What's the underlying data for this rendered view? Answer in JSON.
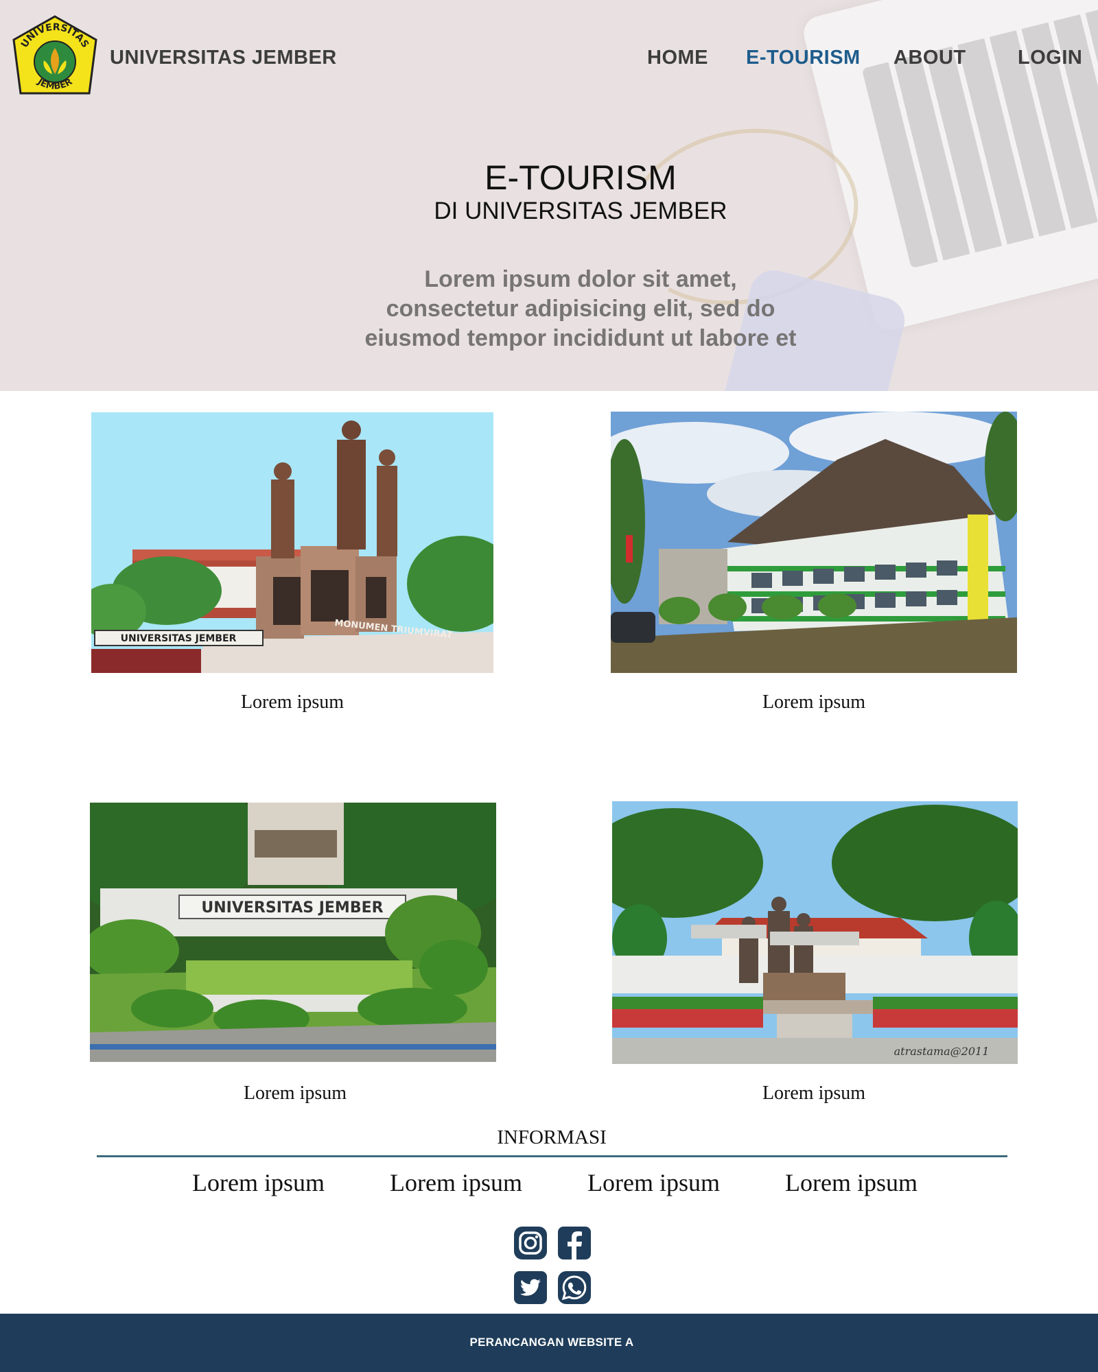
{
  "header": {
    "brand": "UNIVERSITAS JEMBER",
    "logo_ring_text_top": "UNIVERSITAS",
    "logo_ring_text_bottom": "JEMBER",
    "nav": [
      {
        "label": "HOME",
        "active": false
      },
      {
        "label": "E-TOURISM",
        "active": true
      },
      {
        "label": "ABOUT",
        "active": false
      },
      {
        "label": "LOGIN",
        "active": false
      }
    ]
  },
  "hero": {
    "title": "E-TOURISM",
    "subtitle": "DI UNIVERSITAS JEMBER",
    "description_lines": [
      "Lorem ipsum dolor sit amet,",
      "consectetur adipisicing elit, sed do",
      "eiusmod tempor incididunt ut labore et"
    ]
  },
  "gallery": [
    {
      "caption": "Lorem ipsum",
      "image": "monumen-triumvirat-photo",
      "sign_text": "UNIVERSITAS JEMBER",
      "plaque_text": "MONUMEN TRIUMVIRAT"
    },
    {
      "caption": "Lorem ipsum",
      "image": "campus-building-photo"
    },
    {
      "caption": "Lorem ipsum",
      "image": "campus-entrance-sign-photo",
      "sign_text": "UNIVERSITAS JEMBER"
    },
    {
      "caption": "Lorem ipsum",
      "image": "statue-garden-photo",
      "watermark": "atrastama@2011"
    }
  ],
  "info": {
    "title": "INFORMASI",
    "links": [
      "Lorem ipsum",
      "Lorem ipsum",
      "Lorem ipsum",
      "Lorem ipsum"
    ]
  },
  "social": [
    "instagram-icon",
    "facebook-icon",
    "twitter-icon",
    "whatsapp-icon"
  ],
  "footer": {
    "text": "PERANCANGAN WEBSITE A"
  },
  "colors": {
    "hero_bg": "#e9e1e1",
    "nav_active": "#1e5c8c",
    "footer_bg": "#1f3d5a",
    "divider": "#3d6b7c",
    "social": "#1f3d5a"
  }
}
